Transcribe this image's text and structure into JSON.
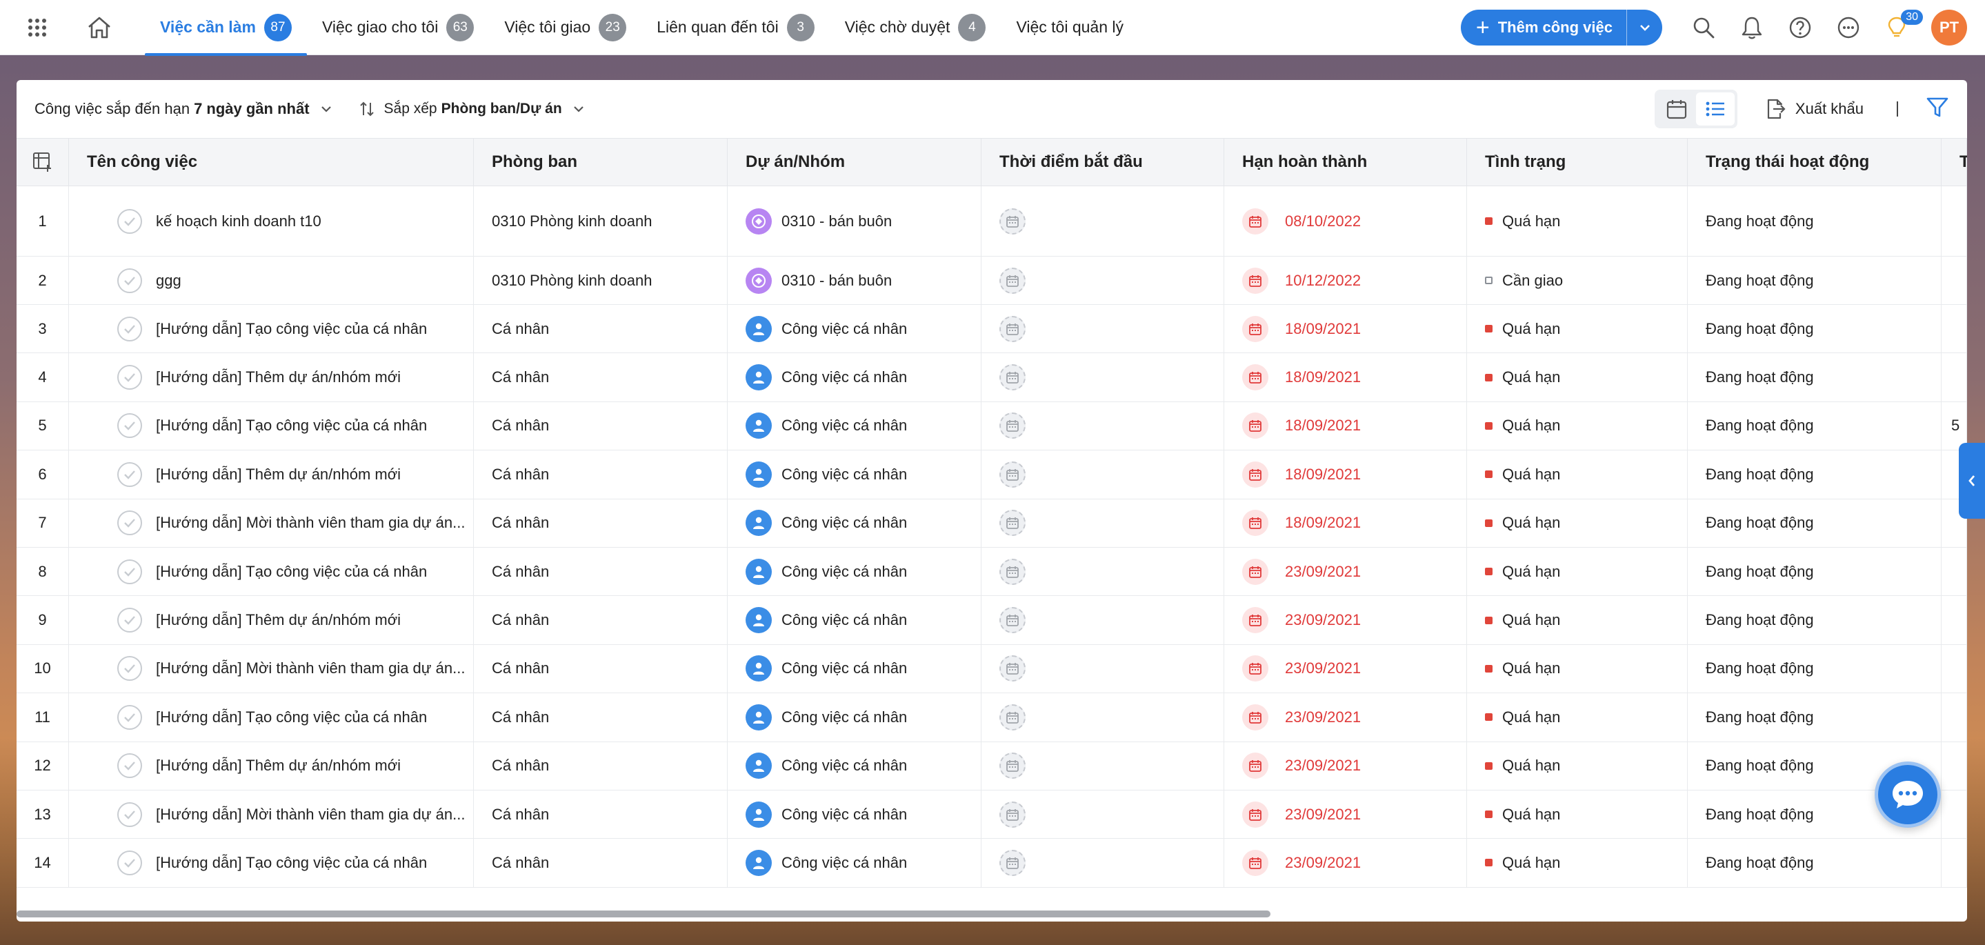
{
  "nav": {
    "tabs": [
      {
        "label": "Việc cần làm",
        "count": "87"
      },
      {
        "label": "Việc giao cho tôi",
        "count": "63"
      },
      {
        "label": "Việc tôi giao",
        "count": "23"
      },
      {
        "label": "Liên quan đến tôi",
        "count": "3"
      },
      {
        "label": "Việc chờ duyệt",
        "count": "4"
      },
      {
        "label": "Việc tôi quản lý",
        "count": ""
      }
    ],
    "add_button": "Thêm công việc",
    "notification_count": "30",
    "avatar_initials": "PT"
  },
  "toolbar": {
    "filter_prefix": "Công việc sắp đến hạn",
    "filter_value": "7 ngày gần nhất",
    "sort_prefix": "Sắp xếp",
    "sort_value": "Phòng ban/Dự án",
    "export_label": "Xuất khẩu"
  },
  "table": {
    "columns": [
      "Tên công việc",
      "Phòng ban",
      "Dự án/Nhóm",
      "Thời điểm bắt đầu",
      "Hạn hoàn thành",
      "Tình trạng",
      "Trạng thái hoạt động",
      "T"
    ],
    "rows": [
      {
        "no": "1",
        "name": "kế hoạch kinh doanh t10",
        "dept": "0310 Phòng kinh doanh",
        "project": "0310 - bán buôn",
        "project_type": "group",
        "due": "08/10/2022",
        "status": "Quá hạn",
        "status_type": "late",
        "activity": "Đang hoạt động",
        "extra": ""
      },
      {
        "no": "2",
        "name": "ggg",
        "dept": "0310 Phòng kinh doanh",
        "project": "0310 - bán buôn",
        "project_type": "group",
        "due": "10/12/2022",
        "status": "Cần giao",
        "status_type": "assign",
        "activity": "Đang hoạt động",
        "extra": ""
      },
      {
        "no": "3",
        "name": "[Hướng dẫn] Tạo công việc của cá nhân",
        "dept": "Cá nhân",
        "project": "Công việc cá nhân",
        "project_type": "personal",
        "due": "18/09/2021",
        "status": "Quá hạn",
        "status_type": "late",
        "activity": "Đang hoạt động",
        "extra": ""
      },
      {
        "no": "4",
        "name": "[Hướng dẫn] Thêm dự án/nhóm mới",
        "dept": "Cá nhân",
        "project": "Công việc cá nhân",
        "project_type": "personal",
        "due": "18/09/2021",
        "status": "Quá hạn",
        "status_type": "late",
        "activity": "Đang hoạt động",
        "extra": ""
      },
      {
        "no": "5",
        "name": "[Hướng dẫn] Tạo công việc của cá nhân",
        "dept": "Cá nhân",
        "project": "Công việc cá nhân",
        "project_type": "personal",
        "due": "18/09/2021",
        "status": "Quá hạn",
        "status_type": "late",
        "activity": "Đang hoạt động",
        "extra": "5"
      },
      {
        "no": "6",
        "name": "[Hướng dẫn] Thêm dự án/nhóm mới",
        "dept": "Cá nhân",
        "project": "Công việc cá nhân",
        "project_type": "personal",
        "due": "18/09/2021",
        "status": "Quá hạn",
        "status_type": "late",
        "activity": "Đang hoạt động",
        "extra": ""
      },
      {
        "no": "7",
        "name": "[Hướng dẫn] Mời thành viên tham gia dự án...",
        "dept": "Cá nhân",
        "project": "Công việc cá nhân",
        "project_type": "personal",
        "due": "18/09/2021",
        "status": "Quá hạn",
        "status_type": "late",
        "activity": "Đang hoạt động",
        "extra": ""
      },
      {
        "no": "8",
        "name": "[Hướng dẫn] Tạo công việc của cá nhân",
        "dept": "Cá nhân",
        "project": "Công việc cá nhân",
        "project_type": "personal",
        "due": "23/09/2021",
        "status": "Quá hạn",
        "status_type": "late",
        "activity": "Đang hoạt động",
        "extra": ""
      },
      {
        "no": "9",
        "name": "[Hướng dẫn] Thêm dự án/nhóm mới",
        "dept": "Cá nhân",
        "project": "Công việc cá nhân",
        "project_type": "personal",
        "due": "23/09/2021",
        "status": "Quá hạn",
        "status_type": "late",
        "activity": "Đang hoạt động",
        "extra": ""
      },
      {
        "no": "10",
        "name": "[Hướng dẫn] Mời thành viên tham gia dự án...",
        "dept": "Cá nhân",
        "project": "Công việc cá nhân",
        "project_type": "personal",
        "due": "23/09/2021",
        "status": "Quá hạn",
        "status_type": "late",
        "activity": "Đang hoạt động",
        "extra": ""
      },
      {
        "no": "11",
        "name": "[Hướng dẫn] Tạo công việc của cá nhân",
        "dept": "Cá nhân",
        "project": "Công việc cá nhân",
        "project_type": "personal",
        "due": "23/09/2021",
        "status": "Quá hạn",
        "status_type": "late",
        "activity": "Đang hoạt động",
        "extra": ""
      },
      {
        "no": "12",
        "name": "[Hướng dẫn] Thêm dự án/nhóm mới",
        "dept": "Cá nhân",
        "project": "Công việc cá nhân",
        "project_type": "personal",
        "due": "23/09/2021",
        "status": "Quá hạn",
        "status_type": "late",
        "activity": "Đang hoạt động",
        "extra": ""
      },
      {
        "no": "13",
        "name": "[Hướng dẫn] Mời thành viên tham gia dự án...",
        "dept": "Cá nhân",
        "project": "Công việc cá nhân",
        "project_type": "personal",
        "due": "23/09/2021",
        "status": "Quá hạn",
        "status_type": "late",
        "activity": "Đang hoạt động",
        "extra": ""
      },
      {
        "no": "14",
        "name": "[Hướng dẫn] Tạo công việc của cá nhân",
        "dept": "Cá nhân",
        "project": "Công việc cá nhân",
        "project_type": "personal",
        "due": "23/09/2021",
        "status": "Quá hạn",
        "status_type": "late",
        "activity": "Đang hoạt động",
        "extra": ""
      }
    ]
  },
  "colors": {
    "accent": "#2a7de1",
    "overdue": "#e03a3a",
    "avatar": "#f07a3a"
  }
}
